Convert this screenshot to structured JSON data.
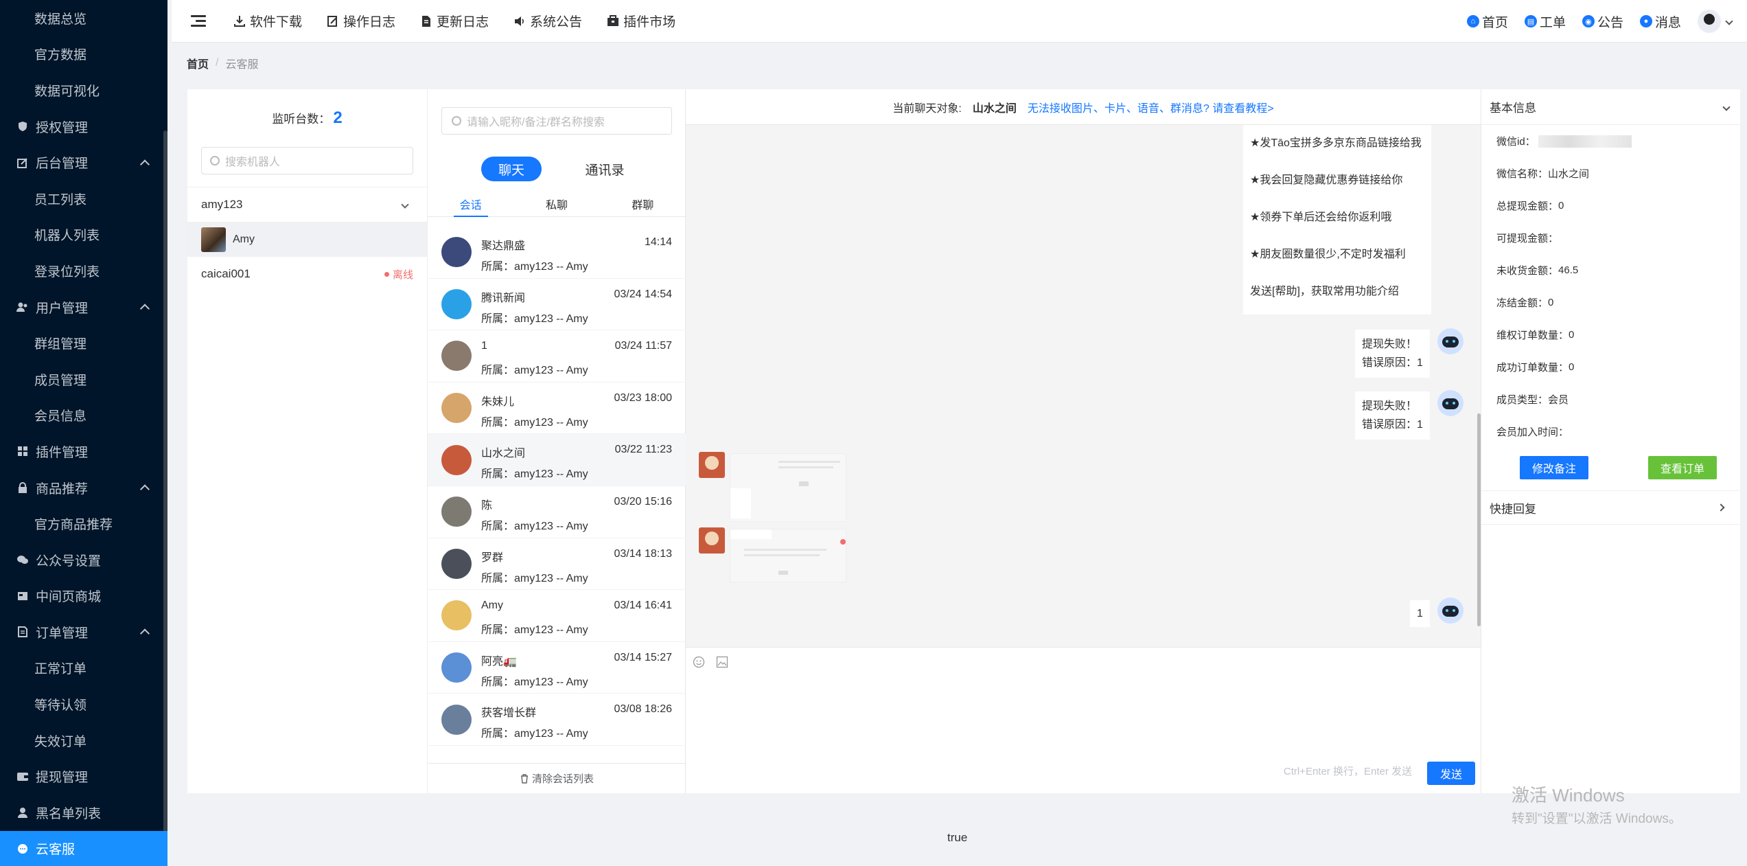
{
  "sidebar": {
    "items": [
      {
        "label": "数据总览",
        "type": "sub"
      },
      {
        "label": "官方数据",
        "type": "sub"
      },
      {
        "label": "数据可视化",
        "type": "sub"
      },
      {
        "label": "授权管理",
        "type": "group",
        "icon": "shield-icon"
      },
      {
        "label": "后台管理",
        "type": "group",
        "icon": "edit-icon",
        "expanded": true
      },
      {
        "label": "员工列表",
        "type": "sub"
      },
      {
        "label": "机器人列表",
        "type": "sub"
      },
      {
        "label": "登录位列表",
        "type": "sub"
      },
      {
        "label": "用户管理",
        "type": "group",
        "icon": "users-icon",
        "expanded": true
      },
      {
        "label": "群组管理",
        "type": "sub"
      },
      {
        "label": "成员管理",
        "type": "sub"
      },
      {
        "label": "会员信息",
        "type": "sub"
      },
      {
        "label": "插件管理",
        "type": "group",
        "icon": "grid-icon"
      },
      {
        "label": "商品推荐",
        "type": "group",
        "icon": "lock-icon",
        "expanded": true
      },
      {
        "label": "官方商品推荐",
        "type": "sub"
      },
      {
        "label": "公众号设置",
        "type": "group",
        "icon": "wechat-icon"
      },
      {
        "label": "中间页商城",
        "type": "group",
        "icon": "page-icon"
      },
      {
        "label": "订单管理",
        "type": "group",
        "icon": "order-icon",
        "expanded": true
      },
      {
        "label": "正常订单",
        "type": "sub"
      },
      {
        "label": "等待认领",
        "type": "sub"
      },
      {
        "label": "失效订单",
        "type": "sub"
      },
      {
        "label": "提现管理",
        "type": "group",
        "icon": "wallet-icon"
      },
      {
        "label": "黑名单列表",
        "type": "group",
        "icon": "user-icon"
      },
      {
        "label": "云客服",
        "type": "group",
        "icon": "chat-icon",
        "active": true
      }
    ]
  },
  "topnav": {
    "left": [
      "软件下载",
      "操作日志",
      "更新日志",
      "系统公告",
      "插件市场"
    ],
    "right": [
      "首页",
      "工单",
      "公告",
      "消息"
    ]
  },
  "breadcrumb": {
    "home": "首页",
    "current": "云客服"
  },
  "robots": {
    "monitor_label": "监听台数：",
    "monitor_count": "2",
    "search_placeholder": "搜索机器人",
    "account1": "amy123",
    "bot1": "Amy",
    "account2": "caicai001",
    "account2_status": "离线"
  },
  "conversations": {
    "search_placeholder": "请输入昵称/备注/群名称搜索",
    "tab_chat": "聊天",
    "tab_contacts": "通讯录",
    "subtabs": [
      "会话",
      "私聊",
      "群聊"
    ],
    "items": [
      {
        "name": "聚达鼎盛",
        "time": "14:14",
        "belong": "所属：amy123 -- Amy",
        "color": "#3b4a7a"
      },
      {
        "name": "腾讯新闻",
        "time": "03/24 14:54",
        "belong": "所属：amy123 -- Amy",
        "color": "#2aa1e6"
      },
      {
        "name": "1",
        "time": "03/24 11:57",
        "belong": "所属：amy123 -- Amy",
        "color": "#8a7a6e"
      },
      {
        "name": "朱妹儿",
        "time": "03/23 18:00",
        "belong": "所属：amy123 -- Amy",
        "color": "#d6a56b"
      },
      {
        "name": "山水之间",
        "time": "03/22 11:23",
        "belong": "所属：amy123 -- Amy",
        "color": "#c85a3c",
        "selected": true
      },
      {
        "name": "陈",
        "time": "03/20 15:16",
        "belong": "所属：amy123 -- Amy",
        "color": "#7d7a72"
      },
      {
        "name": "罗群",
        "time": "03/14 18:13",
        "belong": "所属：amy123 -- Amy",
        "color": "#4b4f5a"
      },
      {
        "name": "Amy",
        "time": "03/14 16:41",
        "belong": "所属：amy123 -- Amy",
        "color": "#e8c063"
      },
      {
        "name": "阿亮🚛",
        "time": "03/14 15:27",
        "belong": "所属：amy123 -- Amy",
        "color": "#5b8fd6"
      },
      {
        "name": "获客增长群",
        "time": "03/08 18:26",
        "belong": "所属：amy123 -- Amy",
        "color": "#6a7f9c"
      }
    ],
    "clear_label": "清除会话列表"
  },
  "chat": {
    "target_label": "当前聊天对象:",
    "target_name": "山水之间",
    "help_link": "无法接收图片、卡片、语音、群消息? 请查看教程>",
    "intro_lines": [
      "★发Tāo宝拼多多京东商品链接给我",
      "★我会回复隐藏优惠券链接给你",
      "★领券下单后还会给你返利哦",
      "★朋友圈数量很少,不定时发福利",
      "发送[帮助]，获取常用功能介绍"
    ],
    "fail1": [
      "提现失败！",
      "错误原因：1"
    ],
    "fail2": [
      "提现失败！",
      "错误原因：1"
    ],
    "last_msg": "1",
    "input_hint": "Ctrl+Enter 换行，Enter 发送",
    "send_label": "发送"
  },
  "info": {
    "title": "基本信息",
    "rows": [
      {
        "label": "微信id：",
        "value": ""
      },
      {
        "label": "微信名称：",
        "value": "山水之间"
      },
      {
        "label": "总提现金额：",
        "value": "0"
      },
      {
        "label": "可提现金额：",
        "value": ""
      },
      {
        "label": "未收货金额：",
        "value": "46.5"
      },
      {
        "label": "冻结金额：",
        "value": "0"
      },
      {
        "label": "维权订单数量：",
        "value": "0"
      },
      {
        "label": "成功订单数量：",
        "value": "0"
      },
      {
        "label": "成员类型：",
        "value": "会员"
      },
      {
        "label": "会员加入时间：",
        "value": ""
      }
    ],
    "btn_edit": "修改备注",
    "btn_orders": "查看订单",
    "quick_reply": "快捷回复"
  },
  "footer": {
    "text": "true"
  },
  "watermark": {
    "line1": "激活 Windows",
    "line2": "转到\"设置\"以激活 Windows。"
  }
}
